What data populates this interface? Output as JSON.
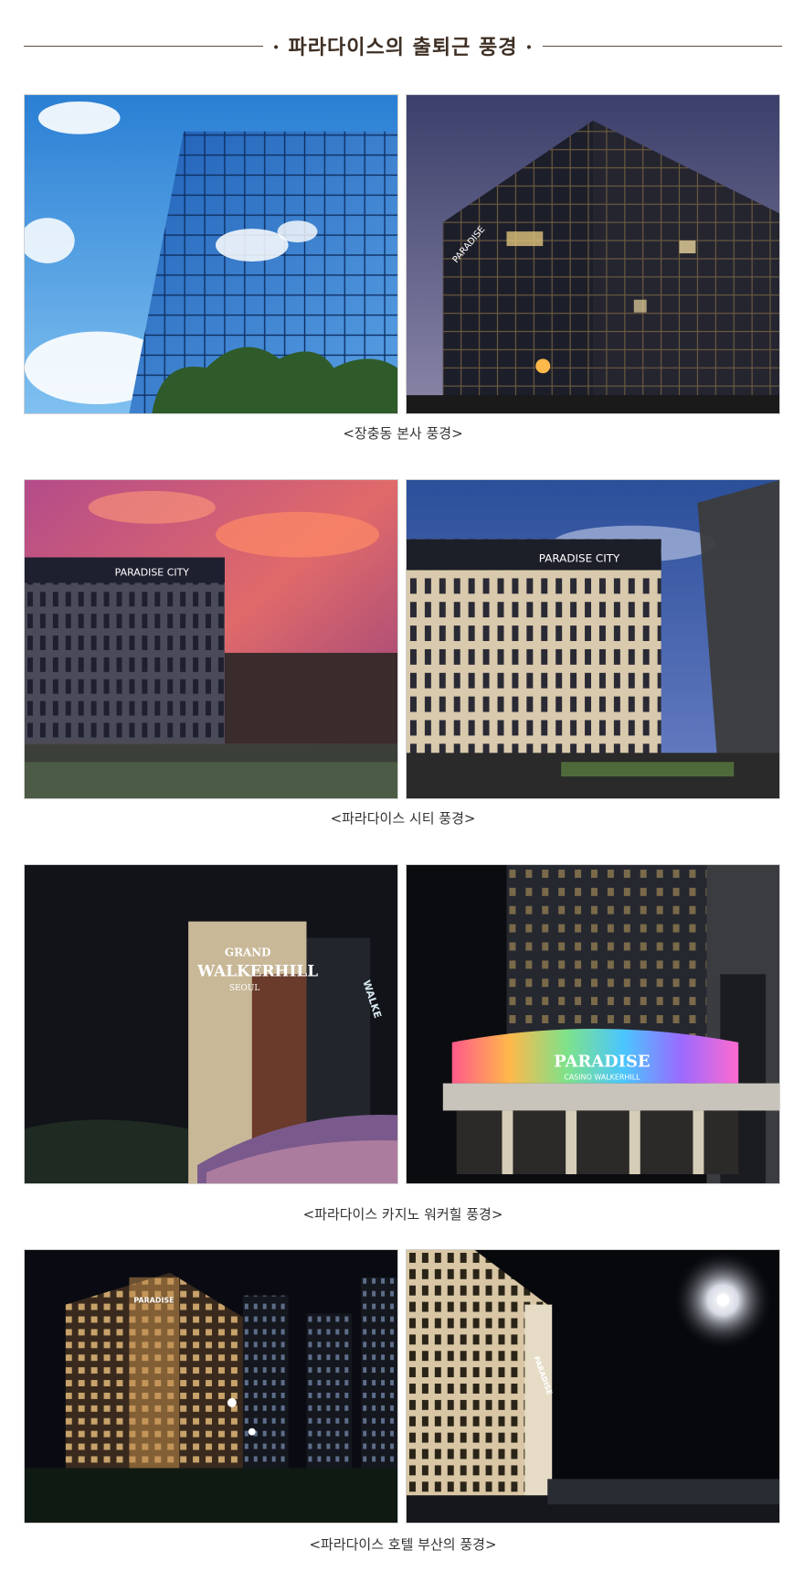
{
  "header": {
    "title": "· 파라다이스의 출퇴근 풍경 ·"
  },
  "sections": [
    {
      "caption": "<장충동 본사 풍경>",
      "logos": {
        "right_building": "PARADISE"
      }
    },
    {
      "caption": "<파라다이스 시티 풍경>",
      "logos": {
        "left_building": "PARADISE CITY",
        "right_building": "PARADISE CITY"
      }
    },
    {
      "caption": "<파라다이스 카지노 워커힐 풍경>",
      "logos": {
        "left_grand": "GRAND",
        "left_walkerhill": "WALKERHILL",
        "left_seoul": "SEOUL",
        "left_side": "WALKE",
        "right_brand": "PARADISE",
        "right_sub": "CASINO WALKERHILL"
      }
    },
    {
      "caption": "<파라다이스 호텔 부산의 풍경>",
      "logos": {
        "left_building": "PARADISE",
        "right_building": "PARADISE"
      }
    }
  ],
  "colors": {
    "header_rule": "#5a4b3f",
    "header_text": "#3e2f24",
    "caption_text": "#333333"
  }
}
